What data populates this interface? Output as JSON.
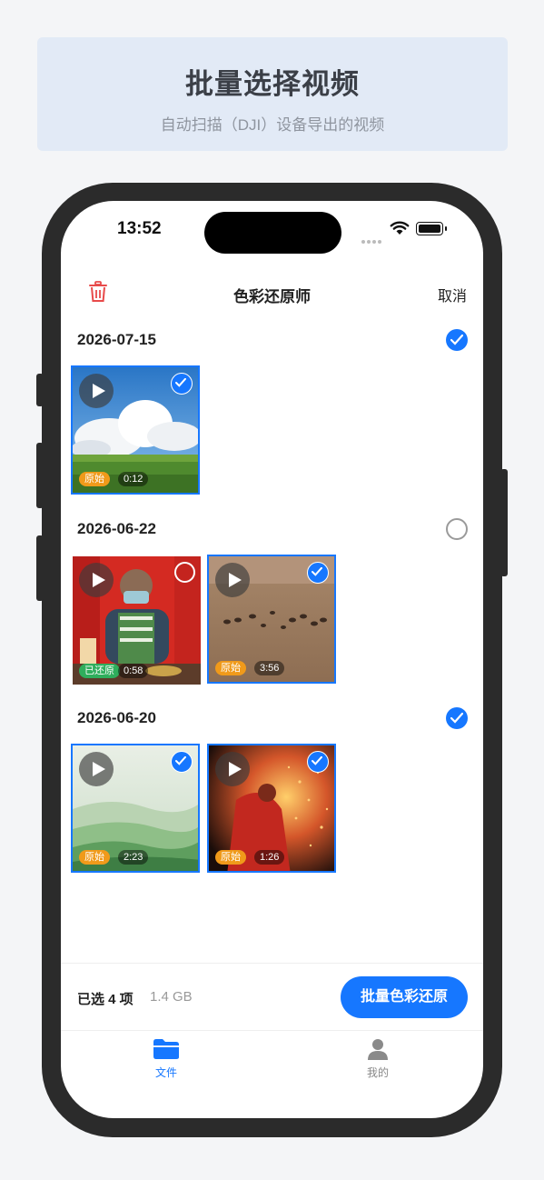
{
  "banner": {
    "title": "批量选择视频",
    "subtitle": "自动扫描（DJI）设备导出的视频"
  },
  "status_bar": {
    "time": "13:52"
  },
  "nav": {
    "title": "色彩还原师",
    "cancel": "取消",
    "trash_icon": "trash-icon"
  },
  "groups": [
    {
      "date": "2026-07-15",
      "all_selected": true,
      "items": [
        {
          "tag": "原始",
          "tag_color": "#f09a1a",
          "duration": "0:12",
          "selected": true,
          "scene": "sky-clouds-grassland"
        }
      ]
    },
    {
      "date": "2026-06-22",
      "all_selected": false,
      "items": [
        {
          "tag": "已还原",
          "tag_color": "#2fae5c",
          "duration": "0:58",
          "selected": false,
          "scene": "man-red-stall"
        },
        {
          "tag": "原始",
          "tag_color": "#f09a1a",
          "duration": "3:56",
          "selected": true,
          "scene": "horses-steppe"
        }
      ]
    },
    {
      "date": "2026-06-20",
      "all_selected": true,
      "items": [
        {
          "tag": "原始",
          "tag_color": "#f09a1a",
          "duration": "2:23",
          "selected": true,
          "scene": "green-misty-hills"
        },
        {
          "tag": "原始",
          "tag_color": "#f09a1a",
          "duration": "1:26",
          "selected": true,
          "scene": "fire-sparks-performer"
        }
      ]
    }
  ],
  "selection": {
    "count_label": "已选 4 项",
    "size_label": "1.4 GB",
    "action_label": "批量色彩还原"
  },
  "tabbar": {
    "files_label": "文件",
    "me_label": "我的"
  },
  "colors": {
    "accent": "#1677ff",
    "danger": "#e84a4a"
  }
}
